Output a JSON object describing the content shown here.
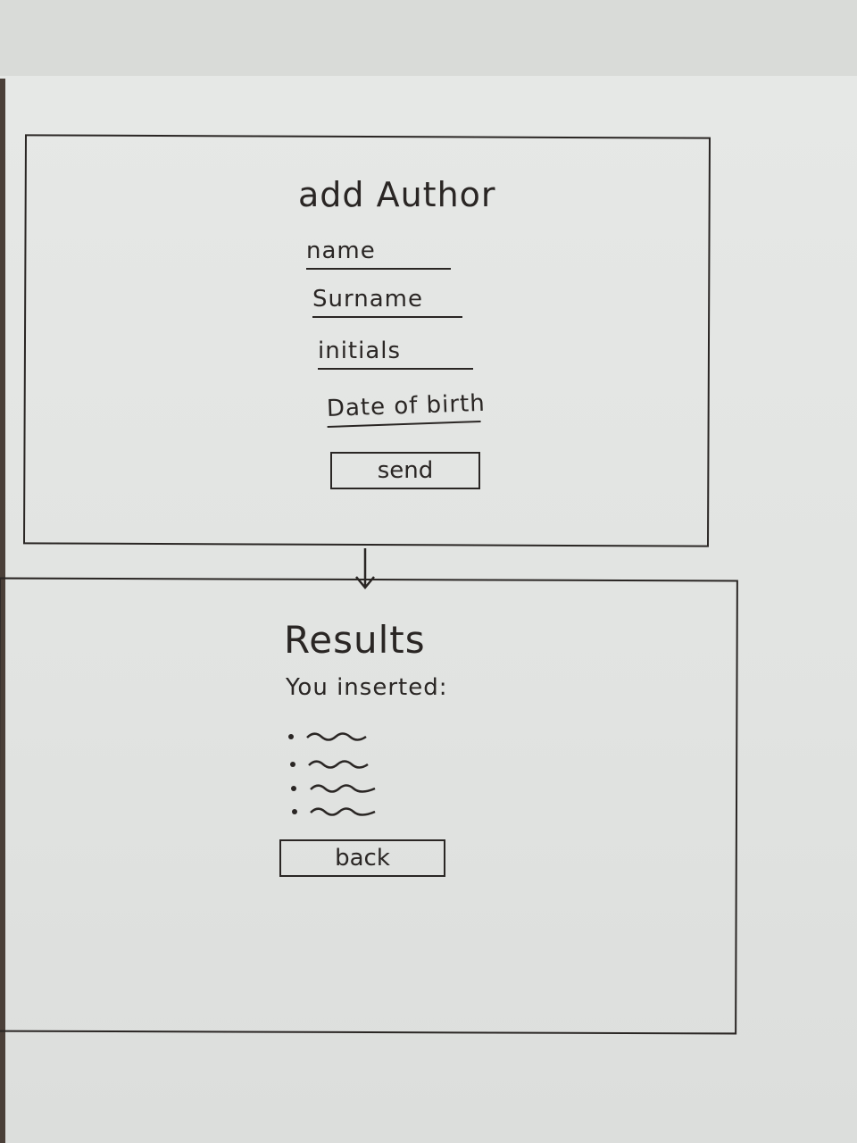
{
  "add_author": {
    "title": "add Author",
    "fields": [
      "name",
      "Surname",
      "initials",
      "Date of birth"
    ],
    "send_label": "send"
  },
  "results": {
    "title": "Results",
    "subtitle": "You inserted:",
    "items_count": 4,
    "back_label": "back"
  }
}
